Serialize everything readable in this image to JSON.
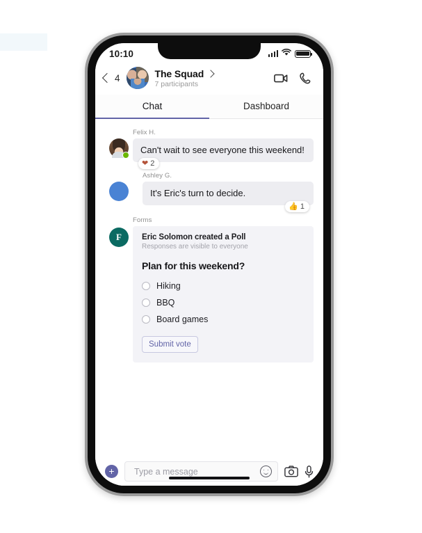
{
  "statusbar": {
    "time": "10:10",
    "signal_icon": "cellular-signal-icon",
    "wifi_icon": "wifi-icon",
    "battery_icon": "battery-icon"
  },
  "header": {
    "back_icon": "chevron-left-icon",
    "back_count": "4",
    "avatar_name": "group-avatar",
    "title": "The Squad",
    "title_chevron_icon": "chevron-right-icon",
    "subtitle": "7 participants",
    "video_call_label": "video-call",
    "audio_call_label": "audio-call"
  },
  "tabs": [
    {
      "label": "Chat",
      "active": true
    },
    {
      "label": "Dashboard",
      "active": false
    }
  ],
  "messages": [
    {
      "sender": "Felix H.",
      "text": "Can't wait to see everyone this weekend!",
      "avatar": "felix-avatar",
      "presence": "available",
      "reaction": {
        "emoji": "❤",
        "kind": "heart",
        "count": "2"
      }
    },
    {
      "sender": "Ashley G.",
      "text": "It's Eric's turn to decide.",
      "avatar": "ashley-avatar",
      "reaction": {
        "emoji": "👍",
        "kind": "thumb",
        "count": "1"
      }
    }
  ],
  "poll": {
    "app_label": "Forms",
    "app_icon_glyph": "F",
    "title": "Eric Solomon created a Poll",
    "subtitle": "Responses are visible to everyone",
    "question": "Plan for this weekend?",
    "options": [
      "Hiking",
      "BBQ",
      "Board games"
    ],
    "submit_label": "Submit vote"
  },
  "compose": {
    "plus_label": "+",
    "placeholder": "Type a message",
    "value": "",
    "emoji_icon": "emoji-smiley-icon",
    "camera_icon": "camera-icon",
    "mic_icon": "microphone-icon"
  },
  "colors": {
    "accent_purple": "#6264a7",
    "bubble_gray": "#ededf1",
    "presence_green": "#6bb700",
    "forms_teal": "#0b6a62",
    "blue_avatar": "#4a83d4"
  }
}
